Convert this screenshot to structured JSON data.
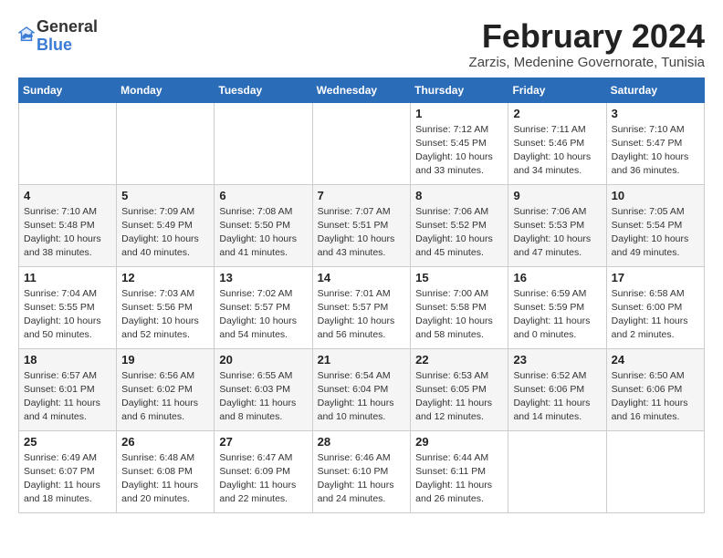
{
  "header": {
    "logo_line1": "General",
    "logo_line2": "Blue",
    "month": "February 2024",
    "location": "Zarzis, Medenine Governorate, Tunisia"
  },
  "days_of_week": [
    "Sunday",
    "Monday",
    "Tuesday",
    "Wednesday",
    "Thursday",
    "Friday",
    "Saturday"
  ],
  "weeks": [
    [
      {
        "num": "",
        "info": ""
      },
      {
        "num": "",
        "info": ""
      },
      {
        "num": "",
        "info": ""
      },
      {
        "num": "",
        "info": ""
      },
      {
        "num": "1",
        "info": "Sunrise: 7:12 AM\nSunset: 5:45 PM\nDaylight: 10 hours\nand 33 minutes."
      },
      {
        "num": "2",
        "info": "Sunrise: 7:11 AM\nSunset: 5:46 PM\nDaylight: 10 hours\nand 34 minutes."
      },
      {
        "num": "3",
        "info": "Sunrise: 7:10 AM\nSunset: 5:47 PM\nDaylight: 10 hours\nand 36 minutes."
      }
    ],
    [
      {
        "num": "4",
        "info": "Sunrise: 7:10 AM\nSunset: 5:48 PM\nDaylight: 10 hours\nand 38 minutes."
      },
      {
        "num": "5",
        "info": "Sunrise: 7:09 AM\nSunset: 5:49 PM\nDaylight: 10 hours\nand 40 minutes."
      },
      {
        "num": "6",
        "info": "Sunrise: 7:08 AM\nSunset: 5:50 PM\nDaylight: 10 hours\nand 41 minutes."
      },
      {
        "num": "7",
        "info": "Sunrise: 7:07 AM\nSunset: 5:51 PM\nDaylight: 10 hours\nand 43 minutes."
      },
      {
        "num": "8",
        "info": "Sunrise: 7:06 AM\nSunset: 5:52 PM\nDaylight: 10 hours\nand 45 minutes."
      },
      {
        "num": "9",
        "info": "Sunrise: 7:06 AM\nSunset: 5:53 PM\nDaylight: 10 hours\nand 47 minutes."
      },
      {
        "num": "10",
        "info": "Sunrise: 7:05 AM\nSunset: 5:54 PM\nDaylight: 10 hours\nand 49 minutes."
      }
    ],
    [
      {
        "num": "11",
        "info": "Sunrise: 7:04 AM\nSunset: 5:55 PM\nDaylight: 10 hours\nand 50 minutes."
      },
      {
        "num": "12",
        "info": "Sunrise: 7:03 AM\nSunset: 5:56 PM\nDaylight: 10 hours\nand 52 minutes."
      },
      {
        "num": "13",
        "info": "Sunrise: 7:02 AM\nSunset: 5:57 PM\nDaylight: 10 hours\nand 54 minutes."
      },
      {
        "num": "14",
        "info": "Sunrise: 7:01 AM\nSunset: 5:57 PM\nDaylight: 10 hours\nand 56 minutes."
      },
      {
        "num": "15",
        "info": "Sunrise: 7:00 AM\nSunset: 5:58 PM\nDaylight: 10 hours\nand 58 minutes."
      },
      {
        "num": "16",
        "info": "Sunrise: 6:59 AM\nSunset: 5:59 PM\nDaylight: 11 hours\nand 0 minutes."
      },
      {
        "num": "17",
        "info": "Sunrise: 6:58 AM\nSunset: 6:00 PM\nDaylight: 11 hours\nand 2 minutes."
      }
    ],
    [
      {
        "num": "18",
        "info": "Sunrise: 6:57 AM\nSunset: 6:01 PM\nDaylight: 11 hours\nand 4 minutes."
      },
      {
        "num": "19",
        "info": "Sunrise: 6:56 AM\nSunset: 6:02 PM\nDaylight: 11 hours\nand 6 minutes."
      },
      {
        "num": "20",
        "info": "Sunrise: 6:55 AM\nSunset: 6:03 PM\nDaylight: 11 hours\nand 8 minutes."
      },
      {
        "num": "21",
        "info": "Sunrise: 6:54 AM\nSunset: 6:04 PM\nDaylight: 11 hours\nand 10 minutes."
      },
      {
        "num": "22",
        "info": "Sunrise: 6:53 AM\nSunset: 6:05 PM\nDaylight: 11 hours\nand 12 minutes."
      },
      {
        "num": "23",
        "info": "Sunrise: 6:52 AM\nSunset: 6:06 PM\nDaylight: 11 hours\nand 14 minutes."
      },
      {
        "num": "24",
        "info": "Sunrise: 6:50 AM\nSunset: 6:06 PM\nDaylight: 11 hours\nand 16 minutes."
      }
    ],
    [
      {
        "num": "25",
        "info": "Sunrise: 6:49 AM\nSunset: 6:07 PM\nDaylight: 11 hours\nand 18 minutes."
      },
      {
        "num": "26",
        "info": "Sunrise: 6:48 AM\nSunset: 6:08 PM\nDaylight: 11 hours\nand 20 minutes."
      },
      {
        "num": "27",
        "info": "Sunrise: 6:47 AM\nSunset: 6:09 PM\nDaylight: 11 hours\nand 22 minutes."
      },
      {
        "num": "28",
        "info": "Sunrise: 6:46 AM\nSunset: 6:10 PM\nDaylight: 11 hours\nand 24 minutes."
      },
      {
        "num": "29",
        "info": "Sunrise: 6:44 AM\nSunset: 6:11 PM\nDaylight: 11 hours\nand 26 minutes."
      },
      {
        "num": "",
        "info": ""
      },
      {
        "num": "",
        "info": ""
      }
    ]
  ]
}
